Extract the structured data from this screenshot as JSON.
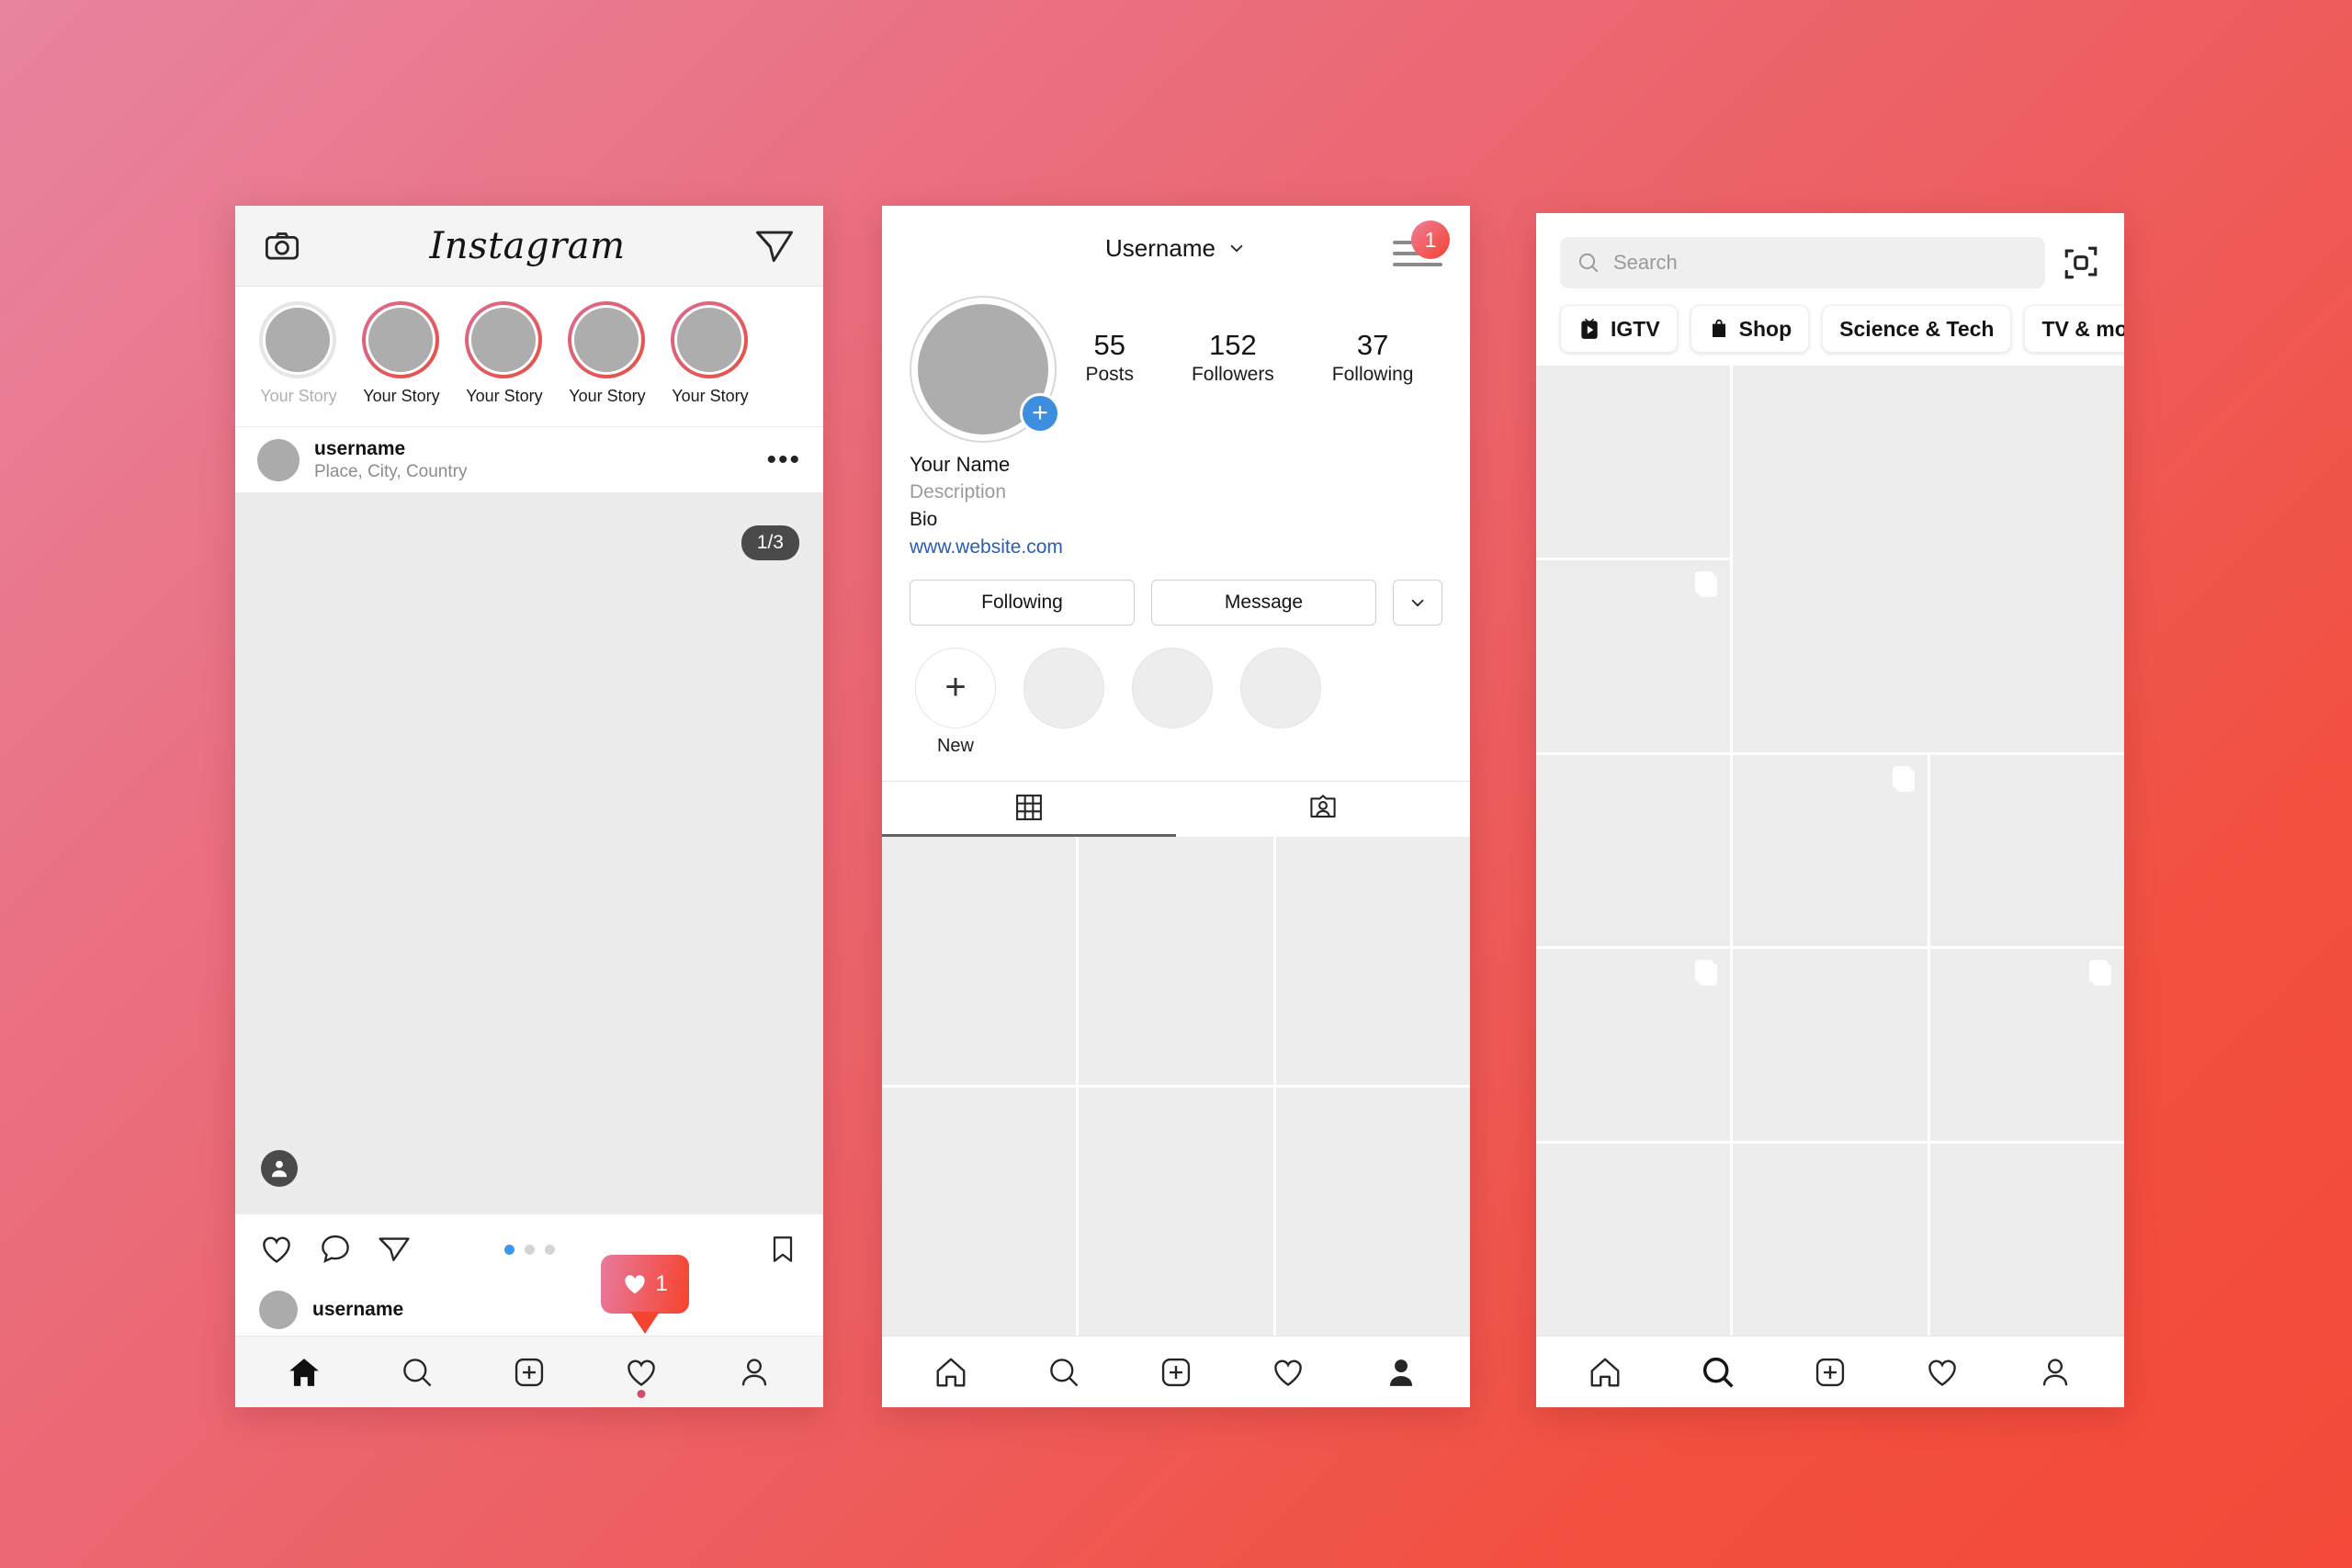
{
  "background": {
    "from": "#e8849f",
    "to": "#f4493a"
  },
  "phone1": {
    "header": {
      "camera_icon": "camera-icon",
      "logo": "Instagram",
      "send_icon": "paper-plane-icon"
    },
    "stories": [
      {
        "label": "Your Story",
        "self": true
      },
      {
        "label": "Your Story",
        "self": false
      },
      {
        "label": "Your Story",
        "self": false
      },
      {
        "label": "Your Story",
        "self": false
      },
      {
        "label": "Your Story",
        "self": false
      }
    ],
    "post": {
      "username": "username",
      "location": "Place, City,  Country",
      "more_icon": "more-options-icon",
      "carousel_badge": "1/3",
      "tag_icon": "tagged-user-icon",
      "like_icon": "heart-icon",
      "comment_icon": "comment-icon",
      "share_icon": "share-icon",
      "save_icon": "bookmark-icon",
      "dots": [
        true,
        false,
        false
      ],
      "like_popup_count": "1",
      "like_popup_icon": "heart-filled-icon",
      "footer_username": "username"
    },
    "nav": [
      {
        "icon": "home-icon",
        "active": true,
        "dot": false
      },
      {
        "icon": "search-icon",
        "active": false,
        "dot": false
      },
      {
        "icon": "new-post-icon",
        "active": false,
        "dot": false
      },
      {
        "icon": "heart-icon",
        "active": false,
        "dot": true
      },
      {
        "icon": "profile-icon",
        "active": false,
        "dot": false
      }
    ]
  },
  "phone2": {
    "header": {
      "title": "Username",
      "chevron_icon": "chevron-down-icon",
      "menu_icon": "hamburger-icon",
      "badge": "1"
    },
    "avatar": {
      "add_icon": "plus-icon"
    },
    "stats": [
      {
        "num": "55",
        "label": "Posts"
      },
      {
        "num": "152",
        "label": "Followers"
      },
      {
        "num": "37",
        "label": "Following"
      }
    ],
    "bio": {
      "name": "Your Name",
      "description": "Description",
      "bio": "Bio",
      "link": "www.website.com"
    },
    "buttons": {
      "following": "Following",
      "message": "Message",
      "more_icon": "chevron-down-icon"
    },
    "highlights": [
      {
        "label": "New",
        "new": true
      },
      {
        "label": "",
        "new": false
      },
      {
        "label": "",
        "new": false
      },
      {
        "label": "",
        "new": false
      }
    ],
    "tabs": [
      {
        "icon": "grid-icon",
        "active": true
      },
      {
        "icon": "tagged-icon",
        "active": false
      }
    ],
    "grid_cells": 6,
    "nav": [
      {
        "icon": "home-icon",
        "active": false
      },
      {
        "icon": "search-icon",
        "active": false
      },
      {
        "icon": "new-post-icon",
        "active": false
      },
      {
        "icon": "heart-icon",
        "active": false
      },
      {
        "icon": "profile-icon",
        "active": true
      }
    ]
  },
  "phone3": {
    "search": {
      "placeholder": "Search",
      "icon": "search-icon",
      "scan_icon": "qr-scan-icon"
    },
    "chips": [
      {
        "label": "IGTV",
        "icon": "igtv-icon"
      },
      {
        "label": "Shop",
        "icon": "shopping-bag-icon"
      },
      {
        "label": "Science & Tech",
        "icon": ""
      },
      {
        "label": "TV & mov",
        "icon": ""
      }
    ],
    "explore_tiles": [
      {
        "big": false,
        "multi": false
      },
      {
        "big": true,
        "multi": false
      },
      {
        "big": false,
        "multi": true
      },
      {
        "big": false,
        "multi": false
      },
      {
        "big": false,
        "multi": true
      },
      {
        "big": false,
        "multi": false
      },
      {
        "big": false,
        "multi": true
      },
      {
        "big": false,
        "multi": false
      },
      {
        "big": false,
        "multi": true
      },
      {
        "big": false,
        "multi": false
      },
      {
        "big": false,
        "multi": false
      },
      {
        "big": false,
        "multi": false
      }
    ],
    "nav": [
      {
        "icon": "home-icon",
        "active": false
      },
      {
        "icon": "search-icon",
        "active": true
      },
      {
        "icon": "new-post-icon",
        "active": false
      },
      {
        "icon": "heart-icon",
        "active": false
      },
      {
        "icon": "profile-icon",
        "active": false
      }
    ]
  }
}
